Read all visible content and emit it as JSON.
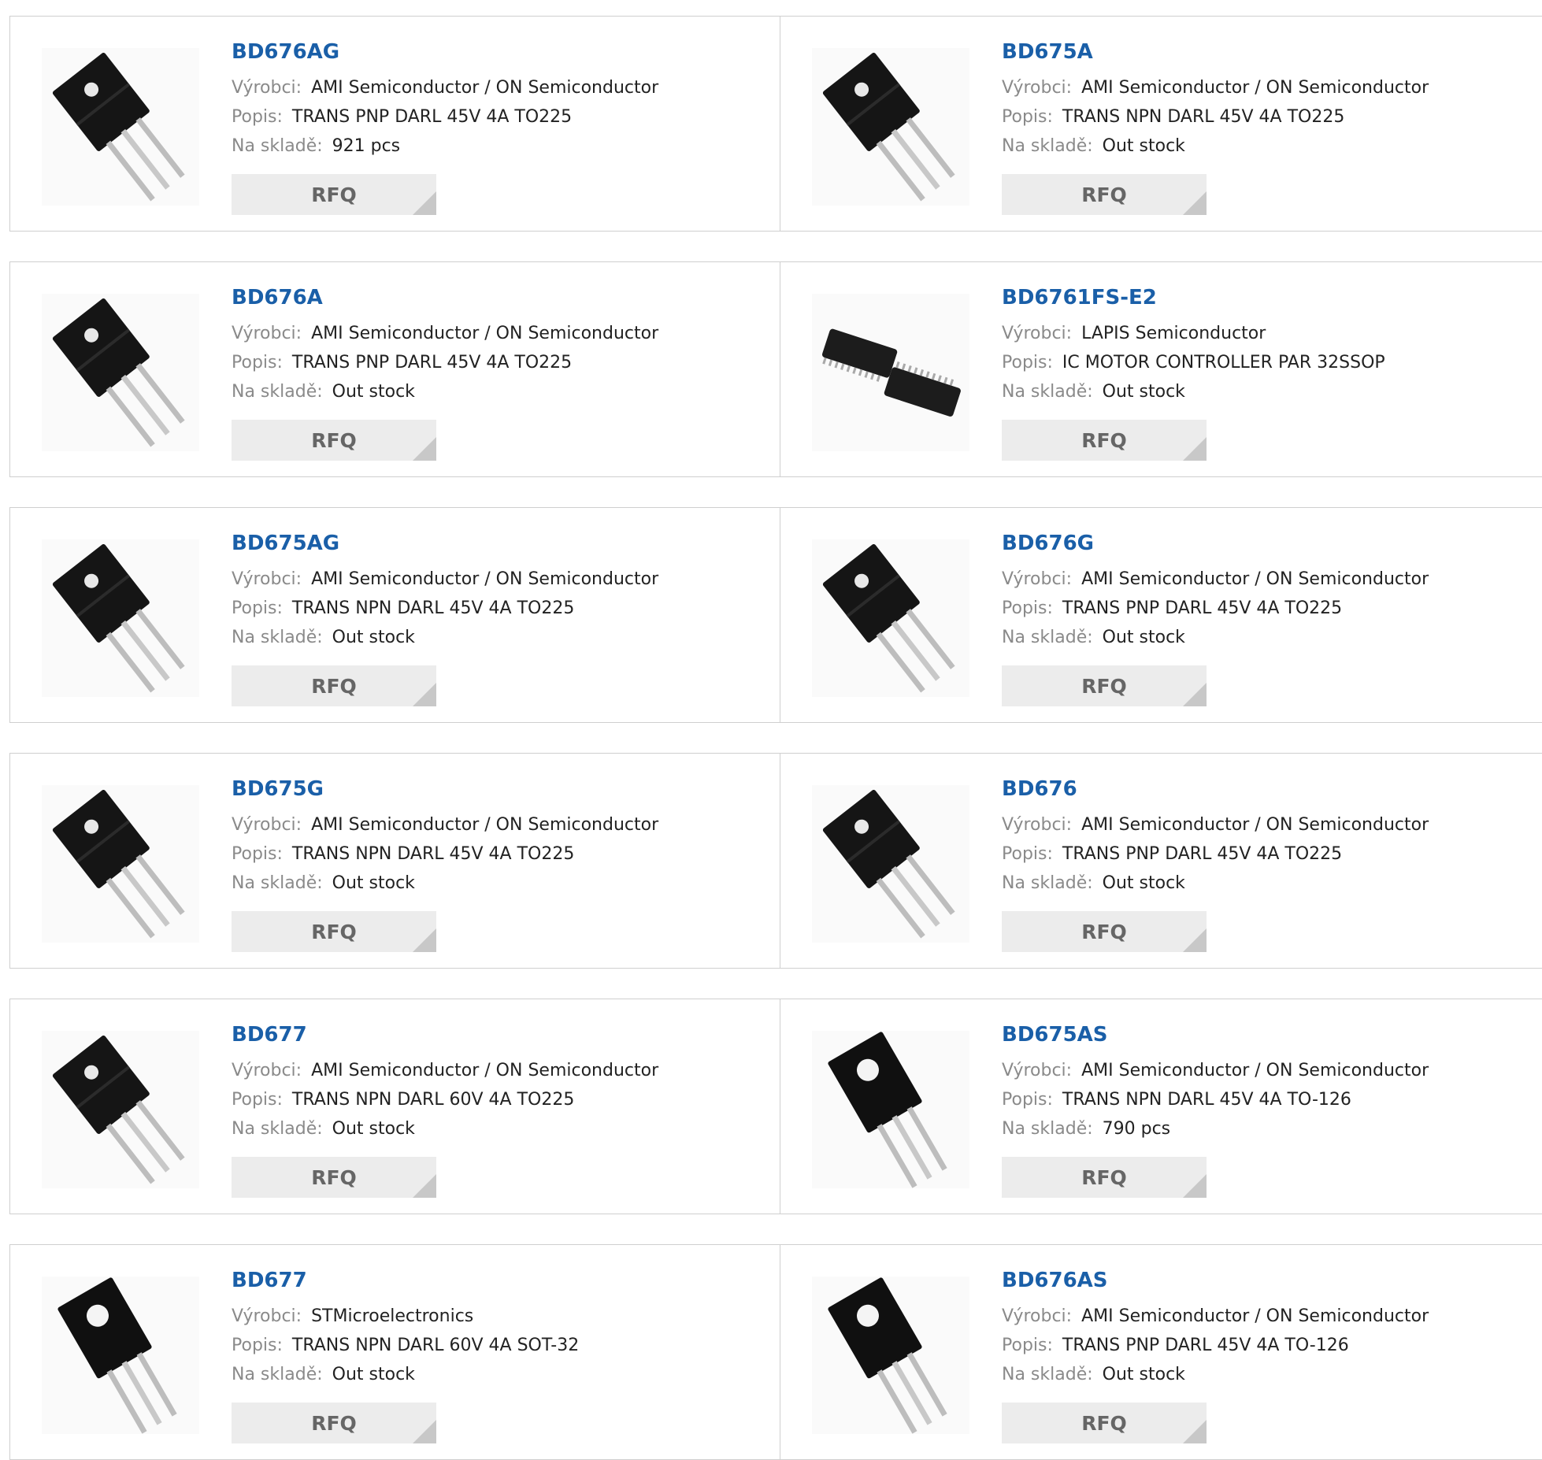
{
  "labels": {
    "manufacturer": "Výrobci:",
    "description": "Popis:",
    "stock": "Na skladě:",
    "rfq": "RFQ"
  },
  "products": [
    {
      "part": "BD676AG",
      "manufacturer": "AMI Semiconductor / ON Semiconductor",
      "description": "TRANS PNP DARL 45V 4A TO225",
      "stock": "921 pcs",
      "image": "to225-transistor"
    },
    {
      "part": "BD675A",
      "manufacturer": "AMI Semiconductor / ON Semiconductor",
      "description": "TRANS NPN DARL 45V 4A TO225",
      "stock": "Out stock",
      "image": "to225-transistor"
    },
    {
      "part": "BD676A",
      "manufacturer": "AMI Semiconductor / ON Semiconductor",
      "description": "TRANS PNP DARL 45V 4A TO225",
      "stock": "Out stock",
      "image": "to225-transistor"
    },
    {
      "part": "BD6761FS-E2",
      "manufacturer": "LAPIS Semiconductor",
      "description": "IC MOTOR CONTROLLER PAR 32SSOP",
      "stock": "Out stock",
      "image": "ssop-ic"
    },
    {
      "part": "BD675AG",
      "manufacturer": "AMI Semiconductor / ON Semiconductor",
      "description": "TRANS NPN DARL 45V 4A TO225",
      "stock": "Out stock",
      "image": "to225-transistor"
    },
    {
      "part": "BD676G",
      "manufacturer": "AMI Semiconductor / ON Semiconductor",
      "description": "TRANS PNP DARL 45V 4A TO225",
      "stock": "Out stock",
      "image": "to225-transistor"
    },
    {
      "part": "BD675G",
      "manufacturer": "AMI Semiconductor / ON Semiconductor",
      "description": "TRANS NPN DARL 45V 4A TO225",
      "stock": "Out stock",
      "image": "to225-transistor"
    },
    {
      "part": "BD676",
      "manufacturer": "AMI Semiconductor / ON Semiconductor",
      "description": "TRANS PNP DARL 45V 4A TO225",
      "stock": "Out stock",
      "image": "to225-transistor"
    },
    {
      "part": "BD677",
      "manufacturer": "AMI Semiconductor / ON Semiconductor",
      "description": "TRANS NPN DARL 60V 4A TO225",
      "stock": "Out stock",
      "image": "to225-transistor"
    },
    {
      "part": "BD675AS",
      "manufacturer": "AMI Semiconductor / ON Semiconductor",
      "description": "TRANS NPN DARL 45V 4A TO-126",
      "stock": "790 pcs",
      "image": "to126-transistor"
    },
    {
      "part": "BD677",
      "manufacturer": "STMicroelectronics",
      "description": "TRANS NPN DARL 60V 4A SOT-32",
      "stock": "Out stock",
      "image": "to126-transistor"
    },
    {
      "part": "BD676AS",
      "manufacturer": "AMI Semiconductor / ON Semiconductor",
      "description": "TRANS PNP DARL 45V 4A TO-126",
      "stock": "Out stock",
      "image": "to126-transistor"
    }
  ]
}
